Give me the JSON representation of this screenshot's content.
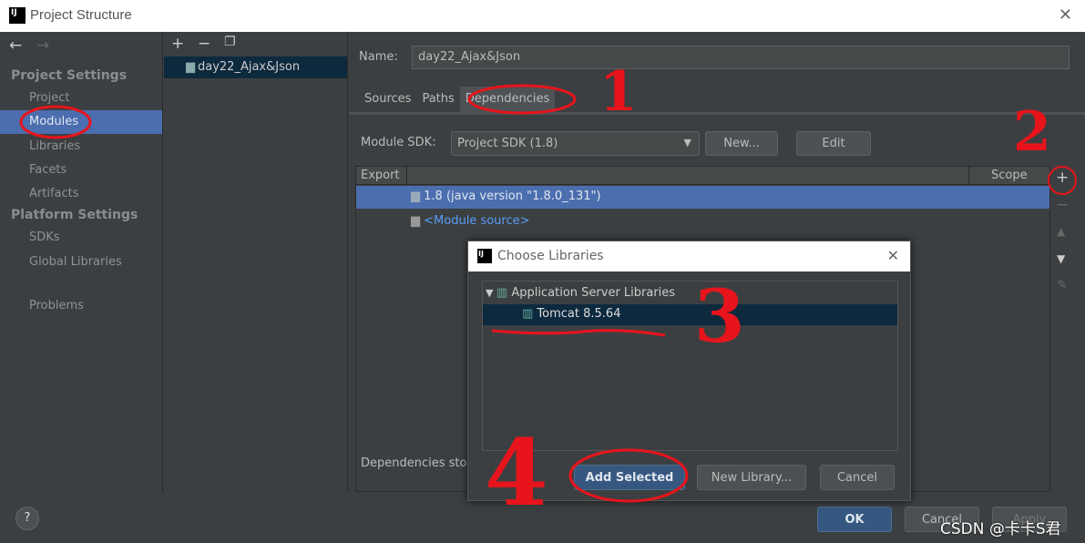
{
  "window": {
    "title": "Project Structure",
    "logo": "IJ"
  },
  "sidebar": {
    "nav_back": "←",
    "nav_fwd": "→",
    "project_settings": "Project Settings",
    "items1": [
      "Project",
      "Modules",
      "Libraries",
      "Facets",
      "Artifacts"
    ],
    "platform_settings": "Platform Settings",
    "items2": [
      "SDKs",
      "Global Libraries"
    ],
    "problems": "Problems"
  },
  "middle": {
    "module": "day22_Ajax&Json"
  },
  "main": {
    "name_label": "Name:",
    "name_value": "day22_Ajax&Json",
    "tabs": [
      "Sources",
      "Paths",
      "Dependencies"
    ],
    "sdk_label": "Module SDK:",
    "sdk_value": "Project SDK (1.8)",
    "new_btn": "New...",
    "edit_btn": "Edit",
    "col_export": "Export",
    "col_scope": "Scope",
    "rows": [
      "1.8 (java version \"1.8.0_131\")",
      "<Module source>"
    ],
    "storage": "Dependencies sto"
  },
  "dialog": {
    "title": "Choose Libraries",
    "group": "Application Server Libraries",
    "lib": "Tomcat 8.5.64",
    "add": "Add Selected",
    "newlib": "New Library...",
    "cancel": "Cancel"
  },
  "footer": {
    "help": "?",
    "ok": "OK",
    "cancel": "Cancel",
    "apply": "Apply",
    "watermark": "CSDN @卡卡S君"
  },
  "annotations": [
    "1",
    "2",
    "3",
    "4"
  ],
  "colors": {
    "selection": "#4b6eaf",
    "annotation": "#e8141b",
    "primary_button": "#365880"
  }
}
